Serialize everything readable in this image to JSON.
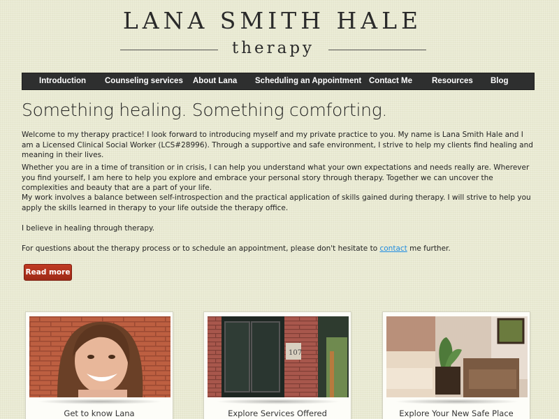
{
  "logo": {
    "name": "LANA SMITH HALE",
    "subtitle": "therapy"
  },
  "nav": [
    {
      "label": "Introduction"
    },
    {
      "label": "Counseling services"
    },
    {
      "label": "About Lana"
    },
    {
      "label": "Scheduling an Appointment"
    },
    {
      "label": "Contact Me"
    },
    {
      "label": "Resources"
    },
    {
      "label": "Blog"
    }
  ],
  "main": {
    "headline": "Something healing. Something comforting.",
    "paragraphs": [
      "Welcome to my therapy practice! I look forward to introducing myself and my private practice to you. My name is Lana Smith Hale and I am a Licensed Clinical Social Worker (LCS#28996). Through a supportive and safe environment, I strive to help my clients find healing and meaning in their lives.",
      "Whether you are in a time of transition or in crisis, I can help you understand what your own expectations and needs really are. Wherever you find yourself, I am here to help you explore and embrace your personal story through therapy. Together we can uncover the complexities and beauty that are a part of your life.",
      "My work involves a balance between self-introspection and the practical application of skills gained during therapy. I will strive to help you apply the skills learned in therapy to your life outside the therapy office.",
      "I believe in healing through therapy."
    ],
    "contact_pre": "For questions about the therapy process or to schedule an appointment, please don't hesitate to ",
    "contact_link": "contact",
    "contact_post": " me further.",
    "read_more": "Read more"
  },
  "cards": [
    {
      "label": "Get to know Lana"
    },
    {
      "label": "Explore Services Offered"
    },
    {
      "label": "Explore Your New Safe Place"
    }
  ],
  "card_images": [
    {
      "icon": "portrait-photo"
    },
    {
      "icon": "building-entrance-photo",
      "number": "107"
    },
    {
      "icon": "office-interior-photo"
    }
  ],
  "colors": {
    "nav_bg": "#2e2f2f",
    "button_red": "#b1321c",
    "link_blue": "#1f8ce0",
    "page_bg": "#e9ead2"
  }
}
